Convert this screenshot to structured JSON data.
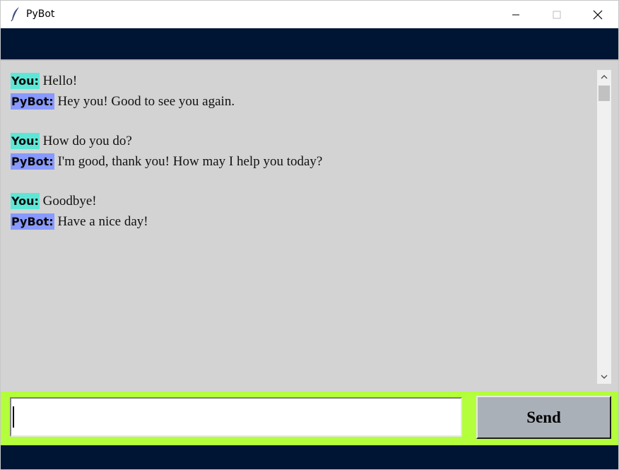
{
  "window": {
    "title": "PyBot",
    "app_icon": "feather-icon",
    "controls": [
      "minimize-icon",
      "maximize-icon",
      "close-icon"
    ]
  },
  "colors": {
    "header_band": "#001533",
    "chat_background": "#d3d3d3",
    "you_tag": "#5de6d6",
    "bot_tag": "#8899ff",
    "input_strip": "#b3ff3b",
    "send_button": "#a9b0b8"
  },
  "chat": {
    "messages": [
      {
        "sender": "You:",
        "text": "Hello!"
      },
      {
        "sender": "PyBot:",
        "text": "Hey you! Good to see you again."
      },
      {
        "sender": "You:",
        "text": "How do you do?"
      },
      {
        "sender": "PyBot:",
        "text": "I'm good, thank you! How may I help you today?"
      },
      {
        "sender": "You:",
        "text": "Goodbye!"
      },
      {
        "sender": "PyBot:",
        "text": "Have a nice day!"
      }
    ]
  },
  "input": {
    "value": "",
    "placeholder": ""
  },
  "send_button": {
    "label": "Send"
  }
}
